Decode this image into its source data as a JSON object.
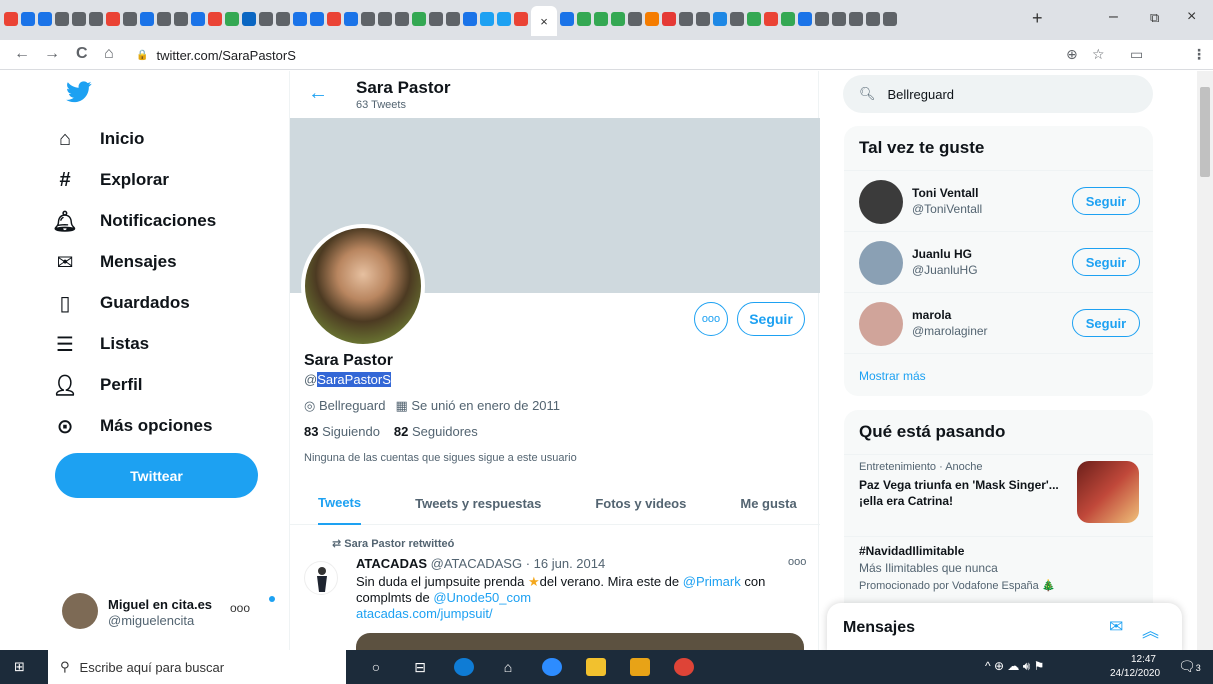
{
  "browser": {
    "tab_colors": [
      "#ea4335",
      "#1a73e8",
      "#1a73e8",
      "#5f6368",
      "#5f6368",
      "#5f6368",
      "#ea4335",
      "#5f6368",
      "#1a73e8",
      "#5f6368",
      "#5f6368",
      "#1a73e8",
      "#ea4335",
      "#34a853",
      "#0a66c2",
      "#5f6368",
      "#5f6368",
      "#1a73e8",
      "#1a73e8",
      "#ea4335",
      "#1a73e8",
      "#5f6368",
      "#5f6368",
      "#5f6368",
      "#34a853",
      "#5f6368",
      "#5f6368",
      "#1a73e8",
      "#1da1f2",
      "#1da1f2",
      "#ea4335"
    ],
    "tab_colors_right": [
      "#1a73e8",
      "#34a853",
      "#34a853",
      "#34a853",
      "#5f6368",
      "#f57c00",
      "#e53935",
      "#5f6368",
      "#5f6368",
      "#1e88e5",
      "#5f6368",
      "#34a853",
      "#ea4335",
      "#34a853",
      "#1a73e8",
      "#5f6368",
      "#5f6368",
      "#5f6368",
      "#5f6368",
      "#5f6368"
    ],
    "active_tab_close": "×",
    "new_tab": "+",
    "minimize": "–",
    "restore": "⧉",
    "close": "×",
    "back": "←",
    "forward": "→",
    "reload": "C",
    "home": "⌂",
    "url": "twitter.com/SaraPastorS",
    "lock": "🔒",
    "add_icon": "⊕",
    "star_icon": "☆",
    "cast_icon": "▭",
    "menu_icon": "⋮"
  },
  "nav": {
    "items": [
      {
        "icon": "⌂",
        "label": "Inicio"
      },
      {
        "icon": "#",
        "label": "Explorar"
      },
      {
        "icon": "🔔︎",
        "label": "Notificaciones"
      },
      {
        "icon": "✉",
        "label": "Mensajes"
      },
      {
        "icon": "▯",
        "label": "Guardados"
      },
      {
        "icon": "☰",
        "label": "Listas"
      },
      {
        "icon": "👤︎",
        "label": "Perfil"
      },
      {
        "icon": "⊙",
        "label": "Más opciones"
      }
    ],
    "tweet_button": "Twittear",
    "account": {
      "name": "Miguel en cita.es",
      "handle": "@miguelencita",
      "more": "ooo"
    }
  },
  "header": {
    "back": "←",
    "name": "Sara Pastor",
    "count": "63 Tweets"
  },
  "profile": {
    "more": "ooo",
    "follow": "Seguir",
    "name": "Sara Pastor",
    "handle_at": "@",
    "handle": "SaraPastorS",
    "location": "Bellreguard",
    "joined": "Se unió en enero de 2011",
    "following_count": "83",
    "following_label": "Siguiendo",
    "followers_count": "82",
    "followers_label": "Seguidores",
    "note": "Ninguna de las cuentas que sigues sigue a este usuario"
  },
  "tabs": [
    "Tweets",
    "Tweets y respuestas",
    "Fotos y videos",
    "Me gusta"
  ],
  "tweet": {
    "retweet_line": "Sara Pastor retwitteó",
    "author": "ATACADAS",
    "handle_date": "@ATACADASG · 16 jun. 2014",
    "more": "ooo",
    "text_1": "Sin duda el jumpsuite prenda ",
    "star": "★",
    "text_2": "del verano. Mira este de ",
    "mention_1": "@Primark",
    "text_3": " con complmts de ",
    "mention_2": "@Unode50_com",
    "link": "atacadas.com/jumpsuit/"
  },
  "search": {
    "value": "Bellreguard",
    "icon": "🔍︎"
  },
  "who_to_follow": {
    "title": "Tal vez te guste",
    "users": [
      {
        "name": "Toni Ventall",
        "handle": "@ToniVentall",
        "button": "Seguir",
        "avatar_color": "#3b3b3b"
      },
      {
        "name": "Juanlu HG",
        "handle": "@JuanluHG",
        "button": "Seguir",
        "avatar_color": "#8aa0b4"
      },
      {
        "name": "marola",
        "handle": "@marolaginer",
        "button": "Seguir",
        "avatar_color": "#d0a49a"
      }
    ],
    "more": "Mostrar más"
  },
  "trends": {
    "title": "Qué está pasando",
    "items": [
      {
        "category": "Entretenimiento · Anoche",
        "title": "Paz Vega triunfa en 'Mask Singer'... ¡ella era Catrina!"
      },
      {
        "title": "#NavidadIlimitable",
        "subtitle": "Más Ilimitables que nunca",
        "promo": "Promocionado por Vodafone España 🎄"
      }
    ]
  },
  "messages": {
    "title": "Mensajes",
    "compose": "✉",
    "expand": "︽"
  },
  "taskbar": {
    "start": "⊞",
    "search_icon": "⚲",
    "search_placeholder": "Escribe aquí para buscar",
    "tray": "^  ⊕  ☁  🔊︎  ⚑",
    "time": "12:47",
    "date": "24/12/2020",
    "notif": "🗨︎",
    "notif_count": "3"
  },
  "colors": {
    "accent": "#1da1f2",
    "text": "#0f1419",
    "muted": "#536471"
  }
}
